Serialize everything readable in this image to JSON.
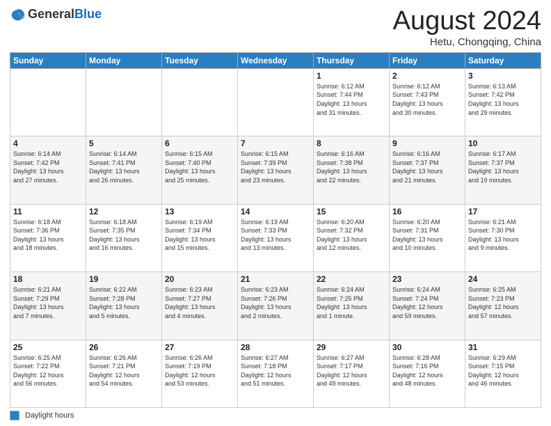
{
  "header": {
    "logo_general": "General",
    "logo_blue": "Blue",
    "month_title": "August 2024",
    "location": "Hetu, Chongqing, China"
  },
  "days_of_week": [
    "Sunday",
    "Monday",
    "Tuesday",
    "Wednesday",
    "Thursday",
    "Friday",
    "Saturday"
  ],
  "weeks": [
    [
      {
        "day": "",
        "info": ""
      },
      {
        "day": "",
        "info": ""
      },
      {
        "day": "",
        "info": ""
      },
      {
        "day": "",
        "info": ""
      },
      {
        "day": "1",
        "info": "Sunrise: 6:12 AM\nSunset: 7:44 PM\nDaylight: 13 hours\nand 31 minutes."
      },
      {
        "day": "2",
        "info": "Sunrise: 6:12 AM\nSunset: 7:43 PM\nDaylight: 13 hours\nand 30 minutes."
      },
      {
        "day": "3",
        "info": "Sunrise: 6:13 AM\nSunset: 7:42 PM\nDaylight: 13 hours\nand 29 minutes."
      }
    ],
    [
      {
        "day": "4",
        "info": "Sunrise: 6:14 AM\nSunset: 7:42 PM\nDaylight: 13 hours\nand 27 minutes."
      },
      {
        "day": "5",
        "info": "Sunrise: 6:14 AM\nSunset: 7:41 PM\nDaylight: 13 hours\nand 26 minutes."
      },
      {
        "day": "6",
        "info": "Sunrise: 6:15 AM\nSunset: 7:40 PM\nDaylight: 13 hours\nand 25 minutes."
      },
      {
        "day": "7",
        "info": "Sunrise: 6:15 AM\nSunset: 7:39 PM\nDaylight: 13 hours\nand 23 minutes."
      },
      {
        "day": "8",
        "info": "Sunrise: 6:16 AM\nSunset: 7:38 PM\nDaylight: 13 hours\nand 22 minutes."
      },
      {
        "day": "9",
        "info": "Sunrise: 6:16 AM\nSunset: 7:37 PM\nDaylight: 13 hours\nand 21 minutes."
      },
      {
        "day": "10",
        "info": "Sunrise: 6:17 AM\nSunset: 7:37 PM\nDaylight: 13 hours\nand 19 minutes."
      }
    ],
    [
      {
        "day": "11",
        "info": "Sunrise: 6:18 AM\nSunset: 7:36 PM\nDaylight: 13 hours\nand 18 minutes."
      },
      {
        "day": "12",
        "info": "Sunrise: 6:18 AM\nSunset: 7:35 PM\nDaylight: 13 hours\nand 16 minutes."
      },
      {
        "day": "13",
        "info": "Sunrise: 6:19 AM\nSunset: 7:34 PM\nDaylight: 13 hours\nand 15 minutes."
      },
      {
        "day": "14",
        "info": "Sunrise: 6:19 AM\nSunset: 7:33 PM\nDaylight: 13 hours\nand 13 minutes."
      },
      {
        "day": "15",
        "info": "Sunrise: 6:20 AM\nSunset: 7:32 PM\nDaylight: 13 hours\nand 12 minutes."
      },
      {
        "day": "16",
        "info": "Sunrise: 6:20 AM\nSunset: 7:31 PM\nDaylight: 13 hours\nand 10 minutes."
      },
      {
        "day": "17",
        "info": "Sunrise: 6:21 AM\nSunset: 7:30 PM\nDaylight: 13 hours\nand 9 minutes."
      }
    ],
    [
      {
        "day": "18",
        "info": "Sunrise: 6:21 AM\nSunset: 7:29 PM\nDaylight: 13 hours\nand 7 minutes."
      },
      {
        "day": "19",
        "info": "Sunrise: 6:22 AM\nSunset: 7:28 PM\nDaylight: 13 hours\nand 5 minutes."
      },
      {
        "day": "20",
        "info": "Sunrise: 6:23 AM\nSunset: 7:27 PM\nDaylight: 13 hours\nand 4 minutes."
      },
      {
        "day": "21",
        "info": "Sunrise: 6:23 AM\nSunset: 7:26 PM\nDaylight: 13 hours\nand 2 minutes."
      },
      {
        "day": "22",
        "info": "Sunrise: 6:24 AM\nSunset: 7:25 PM\nDaylight: 13 hours\nand 1 minute."
      },
      {
        "day": "23",
        "info": "Sunrise: 6:24 AM\nSunset: 7:24 PM\nDaylight: 12 hours\nand 59 minutes."
      },
      {
        "day": "24",
        "info": "Sunrise: 6:25 AM\nSunset: 7:23 PM\nDaylight: 12 hours\nand 57 minutes."
      }
    ],
    [
      {
        "day": "25",
        "info": "Sunrise: 6:25 AM\nSunset: 7:22 PM\nDaylight: 12 hours\nand 56 minutes."
      },
      {
        "day": "26",
        "info": "Sunrise: 6:26 AM\nSunset: 7:21 PM\nDaylight: 12 hours\nand 54 minutes."
      },
      {
        "day": "27",
        "info": "Sunrise: 6:26 AM\nSunset: 7:19 PM\nDaylight: 12 hours\nand 53 minutes."
      },
      {
        "day": "28",
        "info": "Sunrise: 6:27 AM\nSunset: 7:18 PM\nDaylight: 12 hours\nand 51 minutes."
      },
      {
        "day": "29",
        "info": "Sunrise: 6:27 AM\nSunset: 7:17 PM\nDaylight: 12 hours\nand 49 minutes."
      },
      {
        "day": "30",
        "info": "Sunrise: 6:28 AM\nSunset: 7:16 PM\nDaylight: 12 hours\nand 48 minutes."
      },
      {
        "day": "31",
        "info": "Sunrise: 6:29 AM\nSunset: 7:15 PM\nDaylight: 12 hours\nand 46 minutes."
      }
    ]
  ],
  "footer": {
    "legend_label": "Daylight hours"
  }
}
